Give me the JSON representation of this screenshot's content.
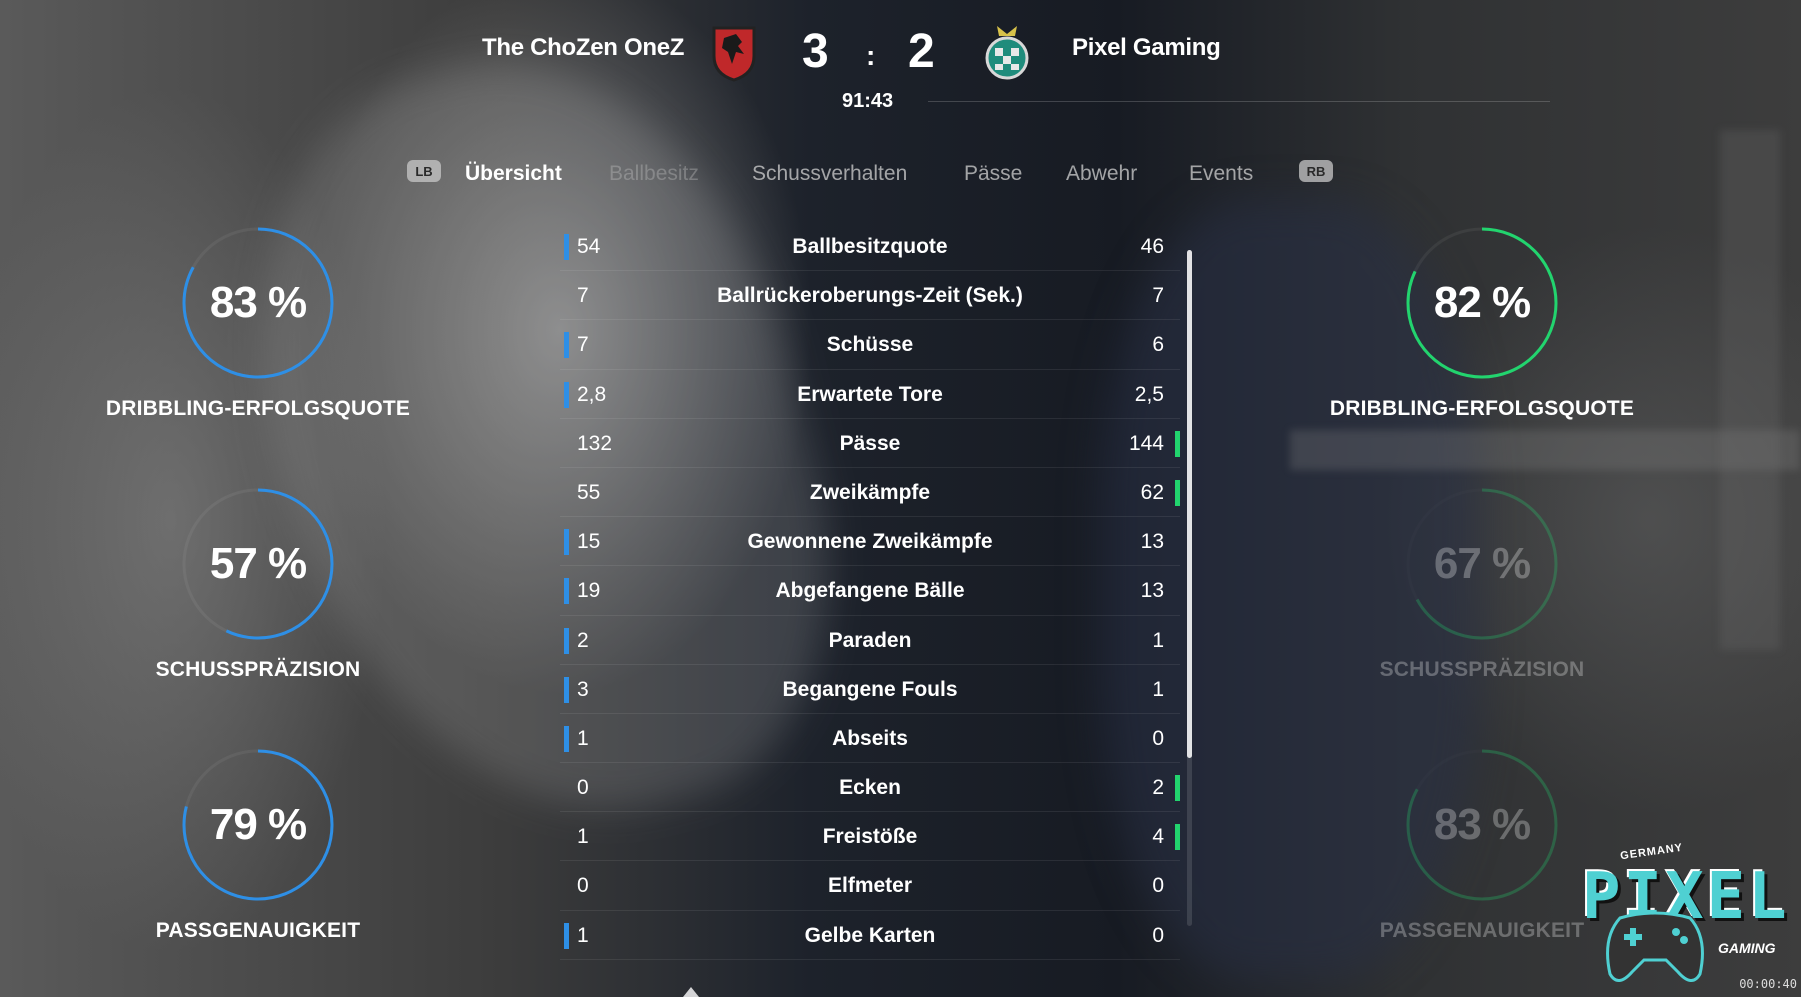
{
  "header": {
    "home_team": "The ChoZen OneZ",
    "away_team": "Pixel Gaming",
    "home_score": "3",
    "score_separator": ":",
    "away_score": "2",
    "match_time": "91:43"
  },
  "tabs": {
    "lb_label": "LB",
    "rb_label": "RB",
    "items": [
      {
        "label": "Übersicht",
        "state": "active"
      },
      {
        "label": "Ballbesitz",
        "state": "dim"
      },
      {
        "label": "Schussverhalten",
        "state": "normal"
      },
      {
        "label": "Pässe",
        "state": "normal"
      },
      {
        "label": "Abwehr",
        "state": "normal"
      },
      {
        "label": "Events",
        "state": "normal"
      }
    ]
  },
  "home_rings": [
    {
      "value": "83 %",
      "percent": 83,
      "label": "DRIBBLING-ERFOLGSQUOTE"
    },
    {
      "value": "57 %",
      "percent": 57,
      "label": "SCHUSSPRÄZISION"
    },
    {
      "value": "79 %",
      "percent": 79,
      "label": "PASSGENAUIGKEIT"
    }
  ],
  "away_rings": [
    {
      "value": "82 %",
      "percent": 82,
      "label": "DRIBBLING-ERFOLGSQUOTE"
    },
    {
      "value": "67 %",
      "percent": 67,
      "label": "SCHUSSPRÄZISION"
    },
    {
      "value": "83 %",
      "percent": 83,
      "label": "PASSGENAUIGKEIT"
    }
  ],
  "stats": [
    {
      "label": "Ballbesitzquote",
      "home": "54",
      "away": "46",
      "leader": "home"
    },
    {
      "label": "Ballrückeroberungs-Zeit (Sek.)",
      "home": "7",
      "away": "7",
      "leader": "none"
    },
    {
      "label": "Schüsse",
      "home": "7",
      "away": "6",
      "leader": "home"
    },
    {
      "label": "Erwartete Tore",
      "home": "2,8",
      "away": "2,5",
      "leader": "home"
    },
    {
      "label": "Pässe",
      "home": "132",
      "away": "144",
      "leader": "away"
    },
    {
      "label": "Zweikämpfe",
      "home": "55",
      "away": "62",
      "leader": "away"
    },
    {
      "label": "Gewonnene Zweikämpfe",
      "home": "15",
      "away": "13",
      "leader": "home"
    },
    {
      "label": "Abgefangene Bälle",
      "home": "19",
      "away": "13",
      "leader": "home"
    },
    {
      "label": "Paraden",
      "home": "2",
      "away": "1",
      "leader": "home"
    },
    {
      "label": "Begangene Fouls",
      "home": "3",
      "away": "1",
      "leader": "home"
    },
    {
      "label": "Abseits",
      "home": "1",
      "away": "0",
      "leader": "home"
    },
    {
      "label": "Ecken",
      "home": "0",
      "away": "2",
      "leader": "away"
    },
    {
      "label": "Freistöße",
      "home": "1",
      "away": "4",
      "leader": "away"
    },
    {
      "label": "Elfmeter",
      "home": "0",
      "away": "0",
      "leader": "none"
    },
    {
      "label": "Gelbe Karten",
      "home": "1",
      "away": "0",
      "leader": "home"
    }
  ],
  "colors": {
    "home_accent": "#2e8fe6",
    "away_accent": "#22d46e",
    "home_crest": "#c0282a",
    "away_crest": "#1f8c7c"
  },
  "logo": {
    "top_text": "GERMANY",
    "word": "PIXEL",
    "sub_text": "GAMING"
  },
  "timestamp": "00:00:40"
}
